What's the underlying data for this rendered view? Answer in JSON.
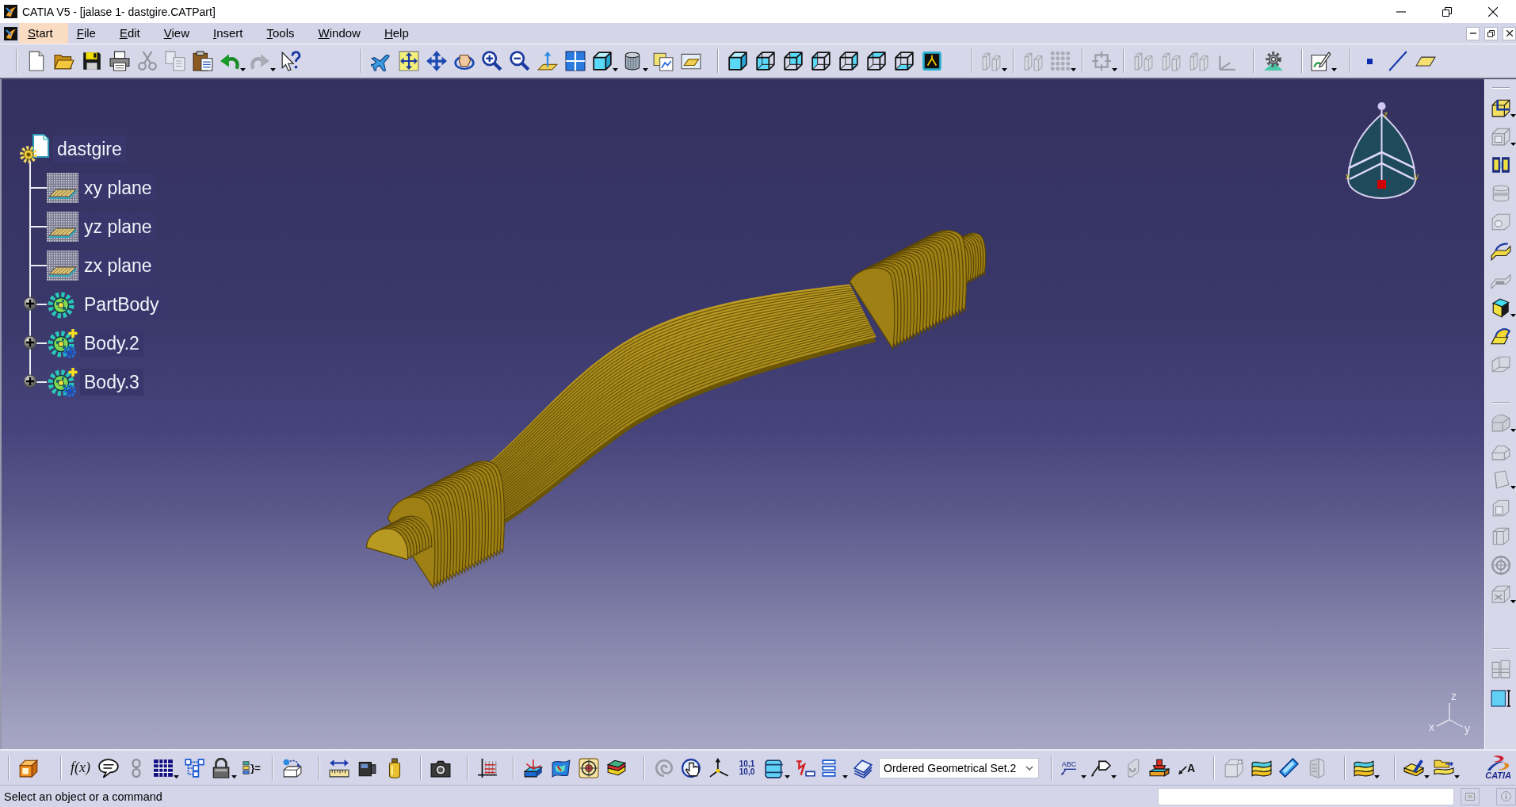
{
  "window": {
    "title": "CATIA V5 - [jalase 1- dastgire.CATPart]"
  },
  "menu_bar": {
    "items": [
      {
        "label": "Start",
        "selected": true
      },
      {
        "label": "File",
        "selected": false
      },
      {
        "label": "Edit",
        "selected": false
      },
      {
        "label": "View",
        "selected": false
      },
      {
        "label": "Insert",
        "selected": false
      },
      {
        "label": "Tools",
        "selected": false
      },
      {
        "label": "Window",
        "selected": false
      },
      {
        "label": "Help",
        "selected": false
      }
    ]
  },
  "top_toolbar": [
    [
      {
        "kind": "new",
        "disabled": false
      },
      {
        "kind": "open",
        "disabled": false
      },
      {
        "kind": "save",
        "disabled": false
      },
      {
        "kind": "print",
        "disabled": false
      },
      {
        "kind": "cut",
        "disabled": true
      },
      {
        "kind": "copy",
        "disabled": true
      },
      {
        "kind": "paste",
        "disabled": false
      },
      {
        "kind": "undo",
        "disabled": false,
        "dropdown": true
      },
      {
        "kind": "redo",
        "disabled": true,
        "dropdown": true
      },
      {
        "kind": "whats_this",
        "disabled": false
      }
    ],
    [
      {
        "kind": "fly",
        "disabled": false
      },
      {
        "kind": "fit_all",
        "disabled": false
      },
      {
        "kind": "pan",
        "disabled": false
      },
      {
        "kind": "rotate",
        "disabled": false
      },
      {
        "kind": "zoom_in",
        "disabled": false
      },
      {
        "kind": "zoom_out",
        "disabled": false
      },
      {
        "kind": "normal_view",
        "disabled": false
      },
      {
        "kind": "multi_view",
        "disabled": false
      },
      {
        "kind": "view_iso",
        "disabled": false,
        "dropdown": true
      },
      {
        "kind": "shading",
        "disabled": false,
        "dropdown": true
      },
      {
        "kind": "hide_show",
        "disabled": false
      },
      {
        "kind": "swap_visible",
        "disabled": false
      }
    ],
    [
      {
        "kind": "view_iso",
        "disabled": false
      },
      {
        "kind": "view_front",
        "disabled": false
      },
      {
        "kind": "view_back",
        "disabled": false
      },
      {
        "kind": "view_left",
        "disabled": false
      },
      {
        "kind": "view_right",
        "disabled": false
      },
      {
        "kind": "view_top",
        "disabled": false
      },
      {
        "kind": "view_bottom",
        "disabled": false
      },
      {
        "kind": "named_views",
        "disabled": false
      }
    ],
    [
      {
        "kind": "parts",
        "disabled": true,
        "dropdown": true
      }
    ],
    [
      {
        "kind": "parts",
        "disabled": true
      },
      {
        "kind": "dot_grid",
        "disabled": true,
        "dropdown": true
      }
    ],
    [
      {
        "kind": "crosshair",
        "disabled": true,
        "dropdown": true
      }
    ],
    [
      {
        "kind": "parts",
        "disabled": true
      },
      {
        "kind": "parts",
        "disabled": true
      },
      {
        "kind": "parts",
        "disabled": true
      },
      {
        "kind": "axis_corner",
        "disabled": true
      }
    ],
    [
      {
        "kind": "settings",
        "disabled": false
      }
    ],
    [
      {
        "kind": "sketch",
        "disabled": false,
        "dropdown": true
      }
    ],
    [
      {
        "kind": "point",
        "disabled": false
      },
      {
        "kind": "line",
        "disabled": false
      },
      {
        "kind": "plane",
        "disabled": false
      }
    ]
  ],
  "specification_tree": {
    "label": "dastgire",
    "children": [
      {
        "kind": "plane",
        "label": "xy plane"
      },
      {
        "kind": "plane",
        "label": "yz plane"
      },
      {
        "kind": "plane",
        "label": "zx plane"
      },
      {
        "kind": "part_body",
        "label": "PartBody",
        "expanded": false
      },
      {
        "kind": "body",
        "label": "Body.2",
        "expanded": false
      },
      {
        "kind": "body",
        "label": "Body.3",
        "expanded": false
      }
    ]
  },
  "compass": {
    "labels": [
      "z",
      "x",
      "y"
    ]
  },
  "axis_triad": {
    "labels": [
      "z",
      "x",
      "y"
    ]
  },
  "right_toolbar": [
    [
      {
        "kind": "pad",
        "disabled": false,
        "dropdown": true
      },
      {
        "kind": "pocket",
        "disabled": true,
        "dropdown": true
      },
      {
        "kind": "shaft",
        "disabled": false
      },
      {
        "kind": "groove",
        "disabled": true
      },
      {
        "kind": "hole",
        "disabled": true
      },
      {
        "kind": "rib",
        "disabled": false
      },
      {
        "kind": "slot",
        "disabled": true
      },
      {
        "kind": "multi_section",
        "disabled": false,
        "dropdown": true
      },
      {
        "kind": "removed_multi_section",
        "disabled": false
      },
      {
        "kind": "stiffener",
        "disabled": true
      }
    ],
    [
      {
        "kind": "fillet",
        "disabled": true,
        "dropdown": true
      },
      {
        "kind": "chamfer",
        "disabled": true
      },
      {
        "kind": "draft",
        "disabled": true,
        "dropdown": true
      },
      {
        "kind": "shell",
        "disabled": true
      },
      {
        "kind": "thickness",
        "disabled": true
      },
      {
        "kind": "thread",
        "disabled": true
      },
      {
        "kind": "remove_face",
        "disabled": true,
        "dropdown": true
      }
    ],
    [
      {
        "kind": "split",
        "disabled": true
      },
      {
        "kind": "box_measure",
        "disabled": false
      }
    ]
  ],
  "bottom_toolbar": [
    [
      {
        "kind": "workbench",
        "disabled": false
      }
    ],
    [
      {
        "kind": "formula",
        "label": "f(x)",
        "disabled": false
      },
      {
        "kind": "comment",
        "disabled": false
      },
      {
        "kind": "link",
        "disabled": true
      },
      {
        "kind": "table",
        "disabled": false,
        "dropdown": true
      },
      {
        "kind": "hierarchy",
        "disabled": false
      },
      {
        "kind": "lock",
        "disabled": false,
        "dropdown": true
      },
      {
        "kind": "rule",
        "label": "}=",
        "disabled": false
      }
    ],
    [
      {
        "kind": "instantiate",
        "disabled": false
      }
    ],
    [
      {
        "kind": "measure",
        "disabled": false
      },
      {
        "kind": "inertia",
        "disabled": false
      },
      {
        "kind": "weight",
        "disabled": false
      }
    ],
    [
      {
        "kind": "capture",
        "disabled": false
      }
    ],
    [
      {
        "kind": "grid_analysis",
        "disabled": false
      }
    ],
    [
      {
        "kind": "box_axes",
        "disabled": false
      },
      {
        "kind": "surface",
        "disabled": false
      },
      {
        "kind": "target",
        "disabled": false
      },
      {
        "kind": "layers",
        "disabled": false
      }
    ],
    [
      {
        "kind": "swirl",
        "disabled": true
      },
      {
        "kind": "hand",
        "disabled": false
      },
      {
        "kind": "axis_system",
        "disabled": false
      },
      {
        "kind": "decimals",
        "lines": [
          "10,1",
          "10,0"
        ],
        "disabled": false
      },
      {
        "kind": "frame_box",
        "disabled": false,
        "dropdown": true
      },
      {
        "kind": "constraint",
        "disabled": false
      },
      {
        "kind": "list",
        "disabled": false,
        "dropdown": true
      },
      {
        "kind": "stack",
        "disabled": false
      },
      {
        "kind": "combo",
        "value": "Ordered Geometrical Set.2",
        "disabled": false
      }
    ],
    [
      {
        "kind": "annotation",
        "label": "ABC",
        "disabled": false,
        "dropdown": true
      },
      {
        "kind": "callout",
        "disabled": false,
        "dropdown": true
      },
      {
        "kind": "hook",
        "disabled": true
      },
      {
        "kind": "stamp",
        "disabled": false
      },
      {
        "kind": "leader",
        "label": "A",
        "disabled": false
      }
    ],
    [
      {
        "kind": "box_outline",
        "disabled": true
      },
      {
        "kind": "sheets",
        "disabled": false
      },
      {
        "kind": "capsule",
        "disabled": false
      },
      {
        "kind": "panel",
        "disabled": true
      }
    ],
    [
      {
        "kind": "sheets",
        "disabled": false,
        "dropdown": true
      }
    ],
    [
      {
        "kind": "edit_sheets",
        "disabled": false,
        "dropdown": true
      },
      {
        "kind": "transfer",
        "disabled": false,
        "dropdown": true
      }
    ]
  ],
  "logo": {
    "text": "CATIA"
  },
  "status_bar": {
    "message": "Select an object or a command"
  }
}
